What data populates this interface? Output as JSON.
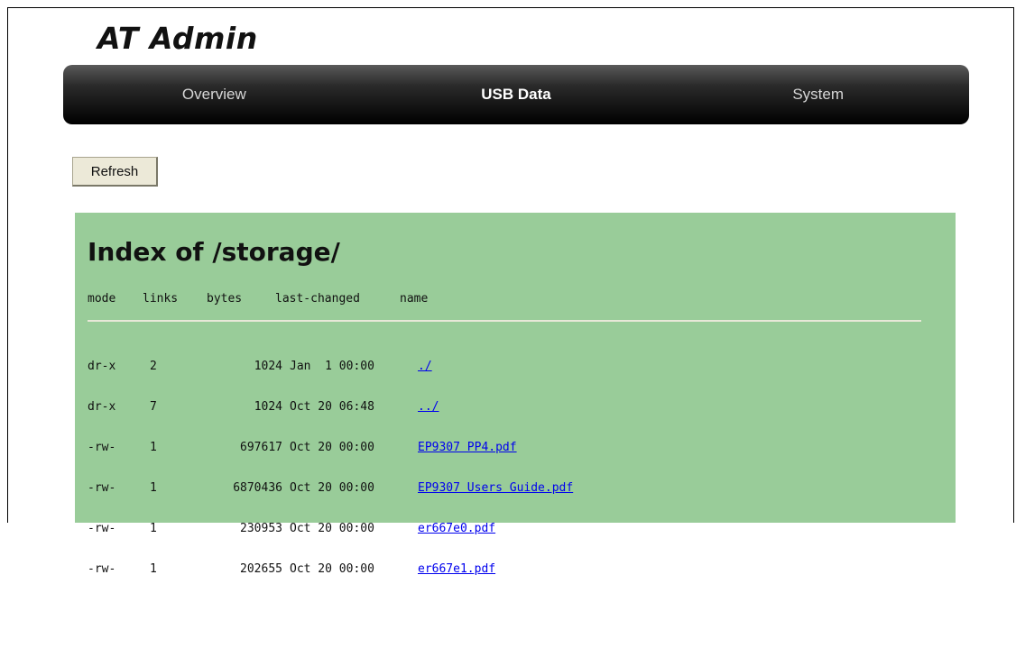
{
  "app": {
    "title": "AT Admin"
  },
  "nav": {
    "items": [
      {
        "label": "Overview"
      },
      {
        "label": "USB Data"
      },
      {
        "label": "System"
      }
    ]
  },
  "toolbar": {
    "refresh_label": "Refresh"
  },
  "listing": {
    "title": "Index of /storage/",
    "columns": [
      "mode",
      "links",
      "bytes",
      "last-changed",
      "name"
    ],
    "rows": [
      {
        "mode": "dr-x",
        "links": "2",
        "bytes": "1024",
        "last_changed": "Jan  1 00:00",
        "name": "./"
      },
      {
        "mode": "dr-x",
        "links": "7",
        "bytes": "1024",
        "last_changed": "Oct 20 06:48",
        "name": "../"
      },
      {
        "mode": "-rw-",
        "links": "1",
        "bytes": "697617",
        "last_changed": "Oct 20 00:00",
        "name": "EP9307 PP4.pdf"
      },
      {
        "mode": "-rw-",
        "links": "1",
        "bytes": "6870436",
        "last_changed": "Oct 20 00:00",
        "name": "EP9307 Users Guide.pdf"
      },
      {
        "mode": "-rw-",
        "links": "1",
        "bytes": "230953",
        "last_changed": "Oct 20 00:00",
        "name": "er667e0.pdf"
      },
      {
        "mode": "-rw-",
        "links": "1",
        "bytes": "202655",
        "last_changed": "Oct 20 00:00",
        "name": "er667e1.pdf"
      }
    ]
  },
  "colors": {
    "listing_background": "#99cc99",
    "link": "#0000ee",
    "nav_text_active": "#ffffff",
    "nav_text": "#d6d6d6"
  }
}
